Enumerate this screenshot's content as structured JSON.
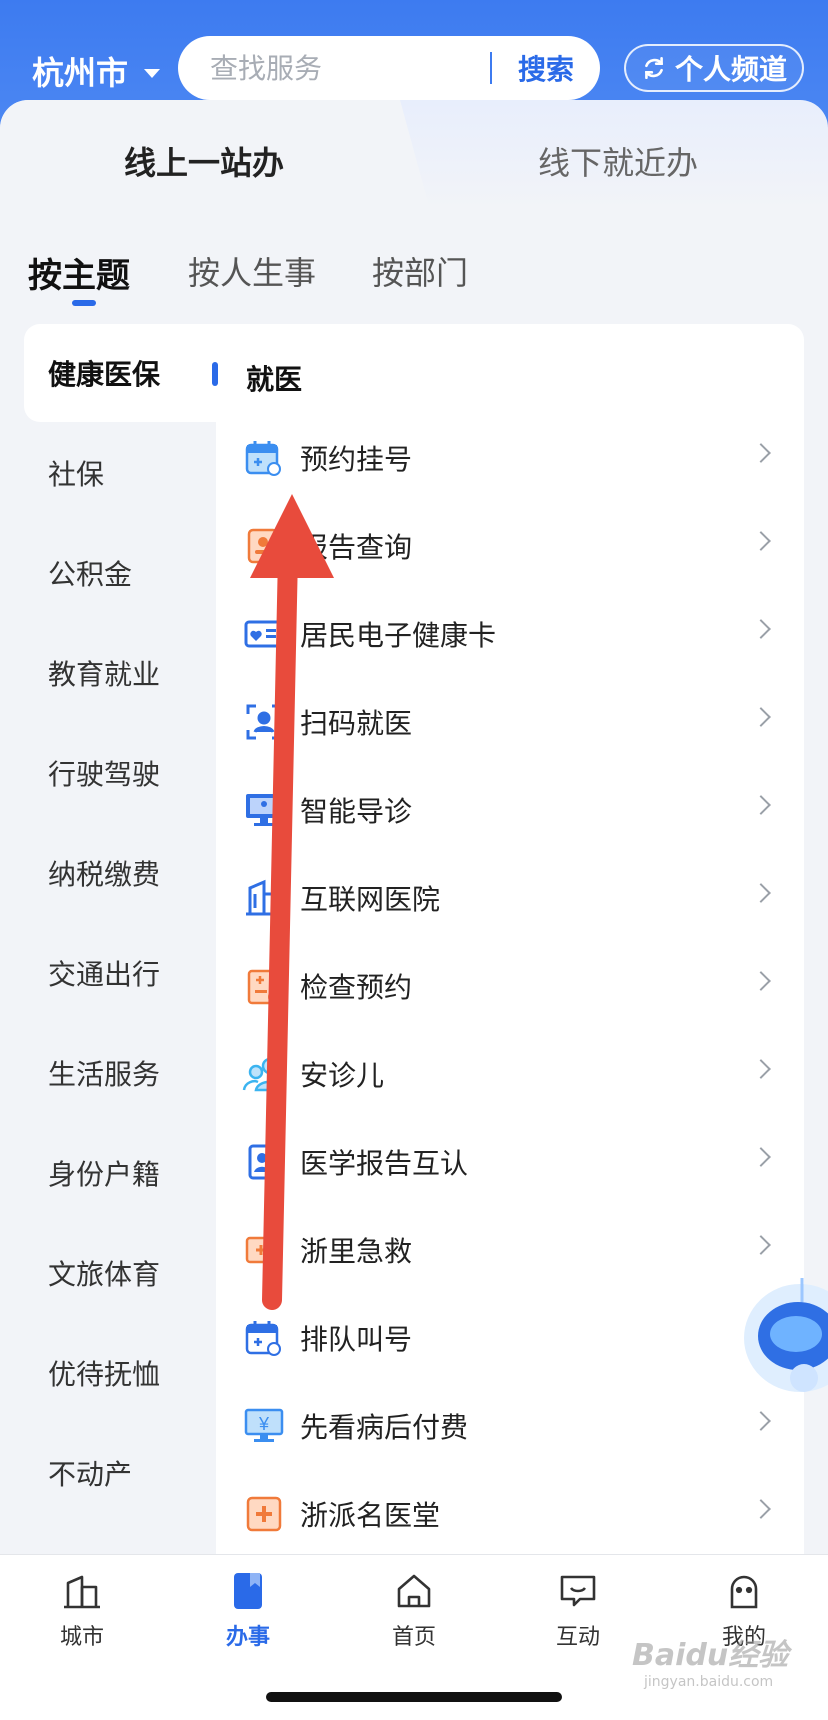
{
  "header": {
    "city": "杭州市",
    "search_placeholder": "查找服务",
    "search_button": "搜索",
    "personal_channel": "个人频道"
  },
  "modes": {
    "online": "线上一站办",
    "offline": "线下就近办"
  },
  "category_tabs": [
    "按主题",
    "按人生事",
    "按部门"
  ],
  "sidebar": {
    "items": [
      "健康医保",
      "社保",
      "公积金",
      "教育就业",
      "行驶驾驶",
      "纳税缴费",
      "交通出行",
      "生活服务",
      "身份户籍",
      "文旅体育",
      "优待抚恤",
      "不动产"
    ]
  },
  "panel": {
    "title": "就医",
    "services": [
      {
        "label": "预约挂号",
        "icon": "calendar-clock-icon",
        "color": "#3b8ef0"
      },
      {
        "label": "报告查询",
        "icon": "report-icon",
        "color": "#f07a3a"
      },
      {
        "label": "居民电子健康卡",
        "icon": "health-card-icon",
        "color": "#2f6fe4"
      },
      {
        "label": "扫码就医",
        "icon": "scan-person-icon",
        "color": "#2f6fe4"
      },
      {
        "label": "智能导诊",
        "icon": "monitor-guide-icon",
        "color": "#2f6fe4"
      },
      {
        "label": "互联网医院",
        "icon": "hospital-building-icon",
        "color": "#2f6fe4"
      },
      {
        "label": "检查预约",
        "icon": "clipboard-check-icon",
        "color": "#f07a3a"
      },
      {
        "label": "安诊儿",
        "icon": "people-icon",
        "color": "#3bb4f0"
      },
      {
        "label": "医学报告互认",
        "icon": "medical-report-icon",
        "color": "#2f6fe4"
      },
      {
        "label": "浙里急救",
        "icon": "first-aid-icon",
        "color": "#f07a3a"
      },
      {
        "label": "排队叫号",
        "icon": "queue-calendar-icon",
        "color": "#2f6fe4"
      },
      {
        "label": "先看病后付费",
        "icon": "yuan-monitor-icon",
        "color": "#3b8ef0"
      },
      {
        "label": "浙派名医堂",
        "icon": "medical-cross-icon",
        "color": "#f07a3a"
      }
    ]
  },
  "bottom_nav": [
    "城市",
    "办事",
    "首页",
    "互动",
    "我的"
  ],
  "watermark": {
    "text": "Baidu经验",
    "url": "jingyan.baidu.com"
  },
  "colors": {
    "primary": "#2a6ae8",
    "header": "#3d7bf0",
    "arrow": "#e84b3c"
  }
}
